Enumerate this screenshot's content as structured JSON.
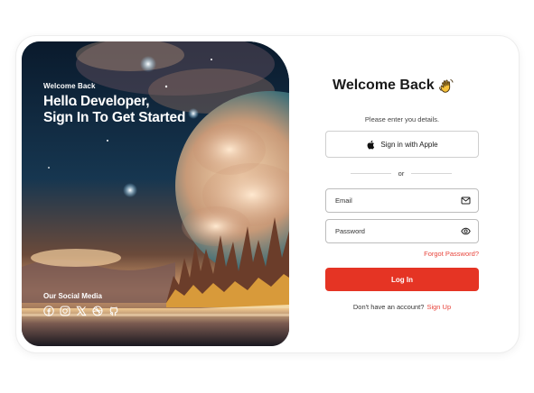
{
  "hero": {
    "small_heading": "Welcome Back",
    "title_line1": "Hello Developer,",
    "title_line2": "Sign In To Get Started",
    "social_title": "Our Social Media",
    "social_icons": [
      "facebook-icon",
      "instagram-icon",
      "x-icon",
      "dribbble-icon",
      "github-icon"
    ]
  },
  "form": {
    "title": "Welcome Back",
    "title_icon": "waving-hand-icon",
    "subtitle": "Please enter you details.",
    "apple_button_label": "Sign in with Apple",
    "divider_text": "or",
    "email_placeholder": "Email",
    "password_placeholder": "Password",
    "forgot_password": "Forgot Password?",
    "login_button": "Log In",
    "no_account_text": "Don't have an account?",
    "signup_link": "Sign Up"
  },
  "colors": {
    "accent": "#e53424",
    "link": "#e8453c",
    "title_text": "#1a1a1a"
  }
}
